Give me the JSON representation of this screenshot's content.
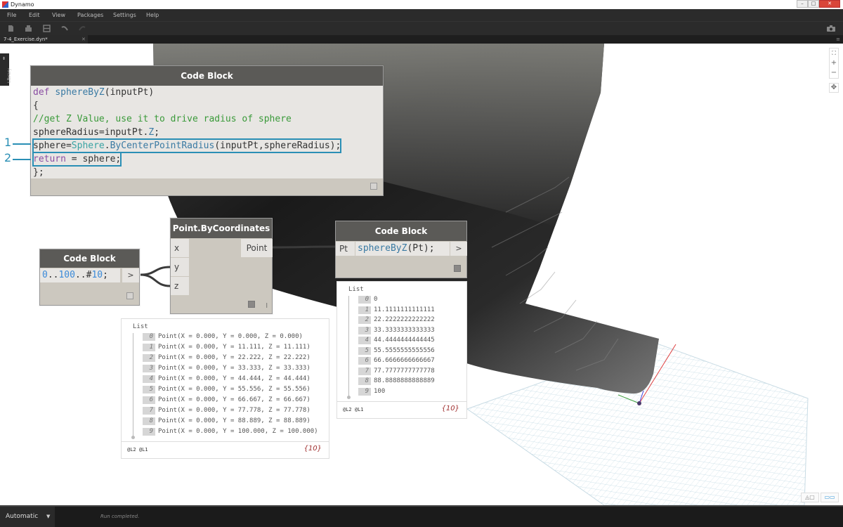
{
  "window": {
    "title": "Dynamo",
    "controls": {
      "minimize": "–",
      "maximize": "□",
      "close": "✕"
    }
  },
  "menu": [
    "File",
    "Edit",
    "View",
    "Packages",
    "Settings",
    "Help"
  ],
  "toolbar": {
    "icons": [
      "new-file-icon",
      "open-file-icon",
      "save-icon",
      "undo-icon",
      "redo-icon"
    ],
    "screenshot_icon": "camera-icon"
  },
  "tab": {
    "label": "7-4_Exercise.dyn*",
    "close": "✕"
  },
  "library": {
    "label": "Library"
  },
  "nav": {
    "fit": "⛶",
    "zoom_in": "+",
    "zoom_out": "−",
    "pan": "✥"
  },
  "view_toggle": {
    "geometry": "◬▢",
    "graph": "▭▭"
  },
  "nodes": {
    "def_block": {
      "title": "Code Block",
      "lines": [
        {
          "parts": [
            {
              "t": "def",
              "c": "kw"
            },
            {
              "t": " "
            },
            {
              "t": "sphereByZ",
              "c": "fn"
            },
            {
              "t": "(inputPt)"
            }
          ]
        },
        {
          "parts": [
            {
              "t": "{"
            }
          ]
        },
        {
          "parts": [
            {
              "t": "//get Z Value, use it to drive radius of sphere",
              "c": "cm"
            }
          ]
        },
        {
          "parts": [
            {
              "t": "sphereRadius=inputPt."
            },
            {
              "t": "Z",
              "c": "fn"
            },
            {
              "t": ";"
            }
          ]
        },
        {
          "parts": [
            {
              "t": "sphere="
            },
            {
              "t": "Sphere",
              "c": "cls"
            },
            {
              "t": "."
            },
            {
              "t": "ByCenterPointRadius",
              "c": "fn"
            },
            {
              "t": "(inputPt,sphereRadius);"
            }
          ],
          "highlight": true
        },
        {
          "parts": [
            {
              "t": "return",
              "c": "kw"
            },
            {
              "t": " = sphere;"
            }
          ],
          "highlight": true
        },
        {
          "parts": [
            {
              "t": "};"
            }
          ]
        }
      ]
    },
    "range_block": {
      "title": "Code Block",
      "code_parts": [
        {
          "t": "0",
          "c": "num"
        },
        {
          "t": ".."
        },
        {
          "t": "100",
          "c": "num"
        },
        {
          "t": "..#"
        },
        {
          "t": "10",
          "c": "num"
        },
        {
          "t": ";"
        }
      ],
      "output": ">"
    },
    "point_node": {
      "title": "Point.ByCoordinates",
      "inputs": [
        "x",
        "y",
        "z"
      ],
      "output": "Point",
      "lacing": "l"
    },
    "call_block": {
      "title": "Code Block",
      "input": "Pt",
      "code_parts": [
        {
          "t": "sphereByZ",
          "c": "fn"
        },
        {
          "t": "(Pt);"
        }
      ],
      "output": ">"
    }
  },
  "watch_points": {
    "label": "List",
    "rows": [
      {
        "i": "0",
        "v": "Point(X = 0.000, Y = 0.000, Z = 0.000)"
      },
      {
        "i": "1",
        "v": "Point(X = 0.000, Y = 11.111, Z = 11.111)"
      },
      {
        "i": "2",
        "v": "Point(X = 0.000, Y = 22.222, Z = 22.222)"
      },
      {
        "i": "3",
        "v": "Point(X = 0.000, Y = 33.333, Z = 33.333)"
      },
      {
        "i": "4",
        "v": "Point(X = 0.000, Y = 44.444, Z = 44.444)"
      },
      {
        "i": "5",
        "v": "Point(X = 0.000, Y = 55.556, Z = 55.556)"
      },
      {
        "i": "6",
        "v": "Point(X = 0.000, Y = 66.667, Z = 66.667)"
      },
      {
        "i": "7",
        "v": "Point(X = 0.000, Y = 77.778, Z = 77.778)"
      },
      {
        "i": "8",
        "v": "Point(X = 0.000, Y = 88.889, Z = 88.889)"
      },
      {
        "i": "9",
        "v": "Point(X = 0.000, Y = 100.000, Z = 100.000)"
      }
    ],
    "levels": "@L2 @L1",
    "count": "{10}"
  },
  "watch_values": {
    "label": "List",
    "rows": [
      {
        "i": "0",
        "v": "0"
      },
      {
        "i": "1",
        "v": "11.1111111111111"
      },
      {
        "i": "2",
        "v": "22.2222222222222"
      },
      {
        "i": "3",
        "v": "33.3333333333333"
      },
      {
        "i": "4",
        "v": "44.4444444444445"
      },
      {
        "i": "5",
        "v": "55.5555555555556"
      },
      {
        "i": "6",
        "v": "66.6666666666667"
      },
      {
        "i": "7",
        "v": "77.7777777777778"
      },
      {
        "i": "8",
        "v": "88.8888888888889"
      },
      {
        "i": "9",
        "v": "100"
      }
    ],
    "levels": "@L2 @L1",
    "count": "{10}"
  },
  "callouts": [
    "1",
    "2"
  ],
  "status": {
    "run_mode": "Automatic",
    "message": "Run completed."
  },
  "colors": {
    "callout": "#2a8fb5",
    "node_header": "#5b5a57",
    "node_body": "#ccc8bf",
    "count": "#a03030"
  }
}
